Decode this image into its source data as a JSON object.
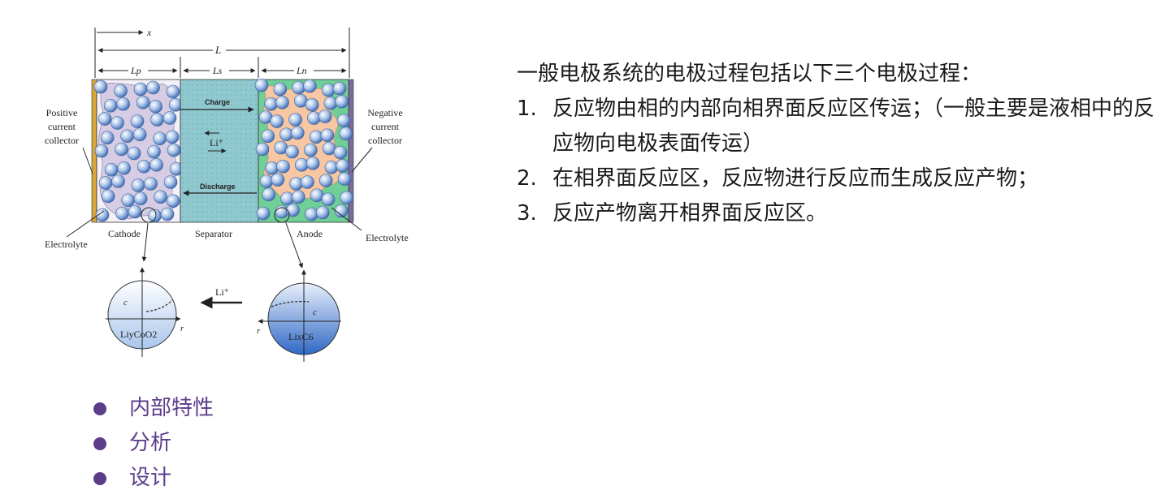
{
  "diagram": {
    "dim_labels": {
      "x": "x",
      "L": "L",
      "Lp": "Lp",
      "Ls": "Ls",
      "Ln": "Ln"
    },
    "labels": {
      "positive_collector": [
        "Positive",
        "current",
        "collector"
      ],
      "negative_collector": [
        "Negative",
        "current",
        "collector"
      ],
      "charge": "Charge",
      "discharge": "Discharge",
      "li_ion": "Li⁺",
      "electrolyte_left": "Electrolyte",
      "cathode": "Cathode",
      "separator": "Separator",
      "anode": "Anode",
      "electrolyte_right": "Electrolyte",
      "li_between": "Li⁺",
      "cathode_conc": "c",
      "anode_conc": "c",
      "r_axis": "r",
      "cathode_material": "LiyCoO2",
      "anode_material": "LixC6"
    },
    "colors": {
      "cathode_bg": "#d6cde4",
      "separator_bg": "#8fc8cf",
      "anode_bg": "#6fcf96",
      "anode_particles": "#f7c6a2",
      "positive_collector": "#d9a63a",
      "negative_collector": "#7d6aa0",
      "sphere_cathode": "#cfe0f4",
      "sphere_anode": "#3f7bd0"
    }
  },
  "right": {
    "intro": "一般电极系统的电极过程包括以下三个电极过程：",
    "items": [
      {
        "num": "1.",
        "text": "反应物由相的内部向相界面反应区传运；（一般主要是液相中的反应物向电极表面传运）"
      },
      {
        "num": "2.",
        "text": "在相界面反应区，反应物进行反应而生成反应产物；"
      },
      {
        "num": "3.",
        "text": "反应产物离开相界面反应区。"
      }
    ]
  },
  "bullets": {
    "color": "#5c3d8a",
    "items": [
      "内部特性",
      "分析",
      "设计"
    ]
  }
}
